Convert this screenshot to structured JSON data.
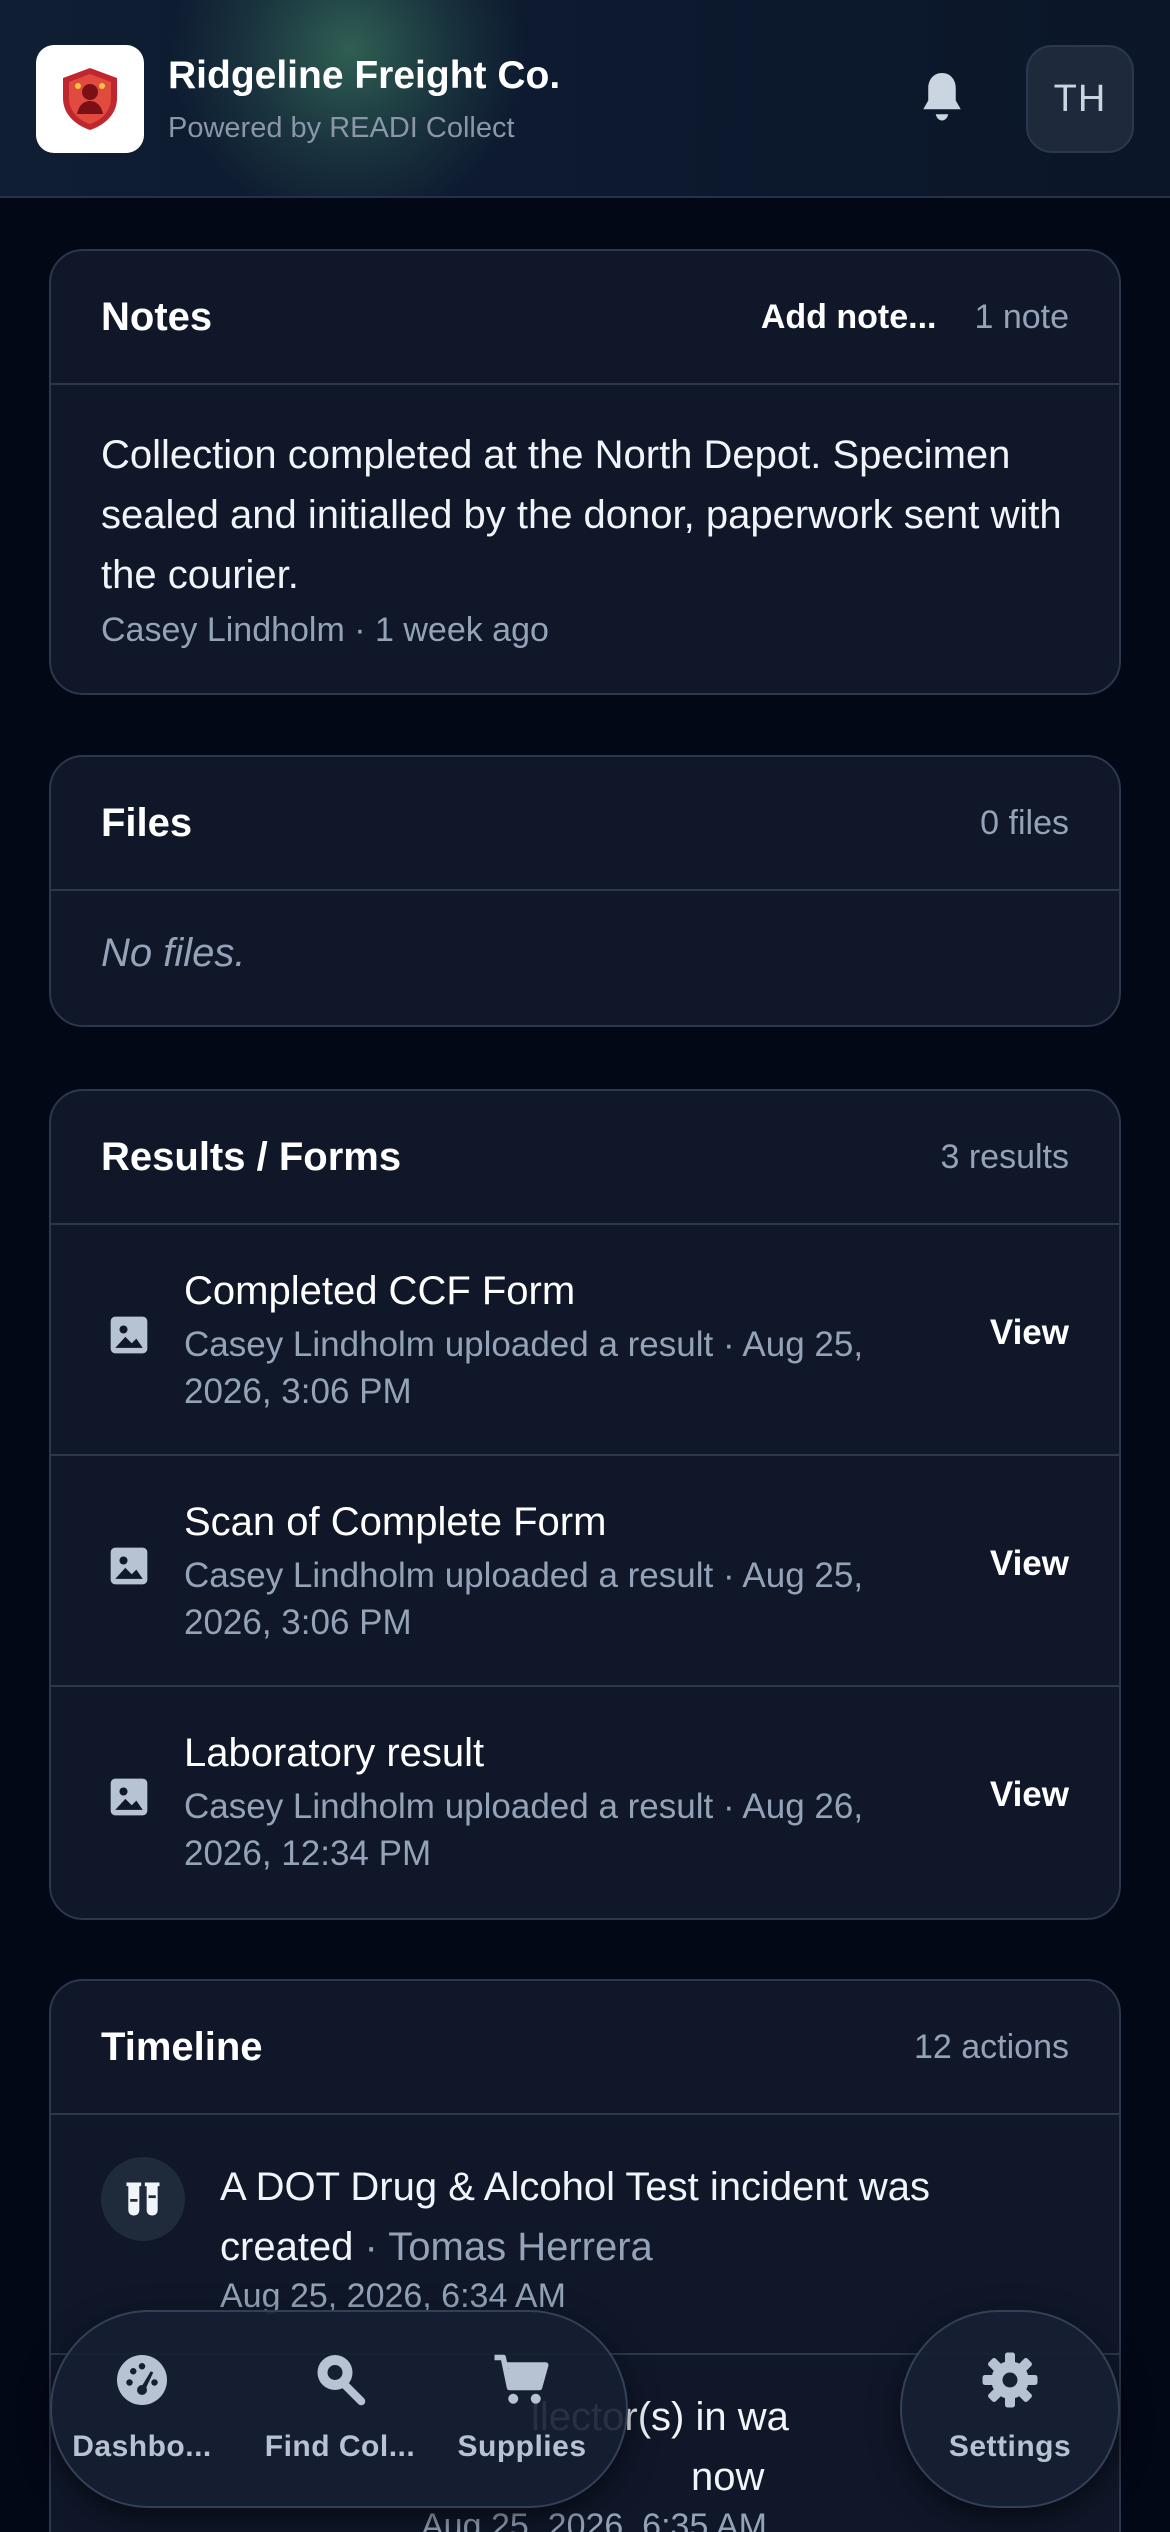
{
  "header": {
    "company": "Ridgeline Freight Co.",
    "powered_by": "Powered by READI Collect",
    "avatar_initials": "TH"
  },
  "notes": {
    "title": "Notes",
    "add_label": "Add note...",
    "count": "1 note",
    "text": "Collection completed at the North Depot. Specimen sealed and initialled by the donor, paperwork sent with the courier.",
    "meta": "Casey Lindholm · 1 week ago"
  },
  "files": {
    "title": "Files",
    "count": "0 files",
    "empty": "No files."
  },
  "results": {
    "title": "Results / Forms",
    "count": "3 results",
    "items": [
      {
        "title": "Completed CCF Form",
        "meta": "Casey Lindholm uploaded a result · Aug 25, 2026, 3:06 PM",
        "action": "View"
      },
      {
        "title": "Scan of Complete Form",
        "meta": "Casey Lindholm uploaded a result · Aug 25, 2026, 3:06 PM",
        "action": "View"
      },
      {
        "title": "Laboratory result",
        "meta": "Casey Lindholm uploaded a result · Aug 26, 2026, 12:34 PM",
        "action": "View"
      }
    ]
  },
  "timeline": {
    "title": "Timeline",
    "count": "12 actions",
    "items": [
      {
        "text": "A DOT Drug & Alcohol Test incident was created",
        "actor": "Tomas Herrera",
        "date": "Aug 25, 2026, 6:34 AM"
      },
      {
        "text_partial": "llector(s) in wa",
        "text_partial2": "now",
        "date_partial": "Aug 25, 2026, 6:35 AM"
      }
    ]
  },
  "nav": {
    "dashboard": "Dashbo...",
    "find": "Find Col...",
    "supplies": "Supplies",
    "settings": "Settings"
  },
  "colors": {
    "background": "#030817",
    "card": "#0f1729",
    "border": "#2b374b",
    "muted_text": "#94a3b8",
    "logo_red": "#c0262d"
  }
}
